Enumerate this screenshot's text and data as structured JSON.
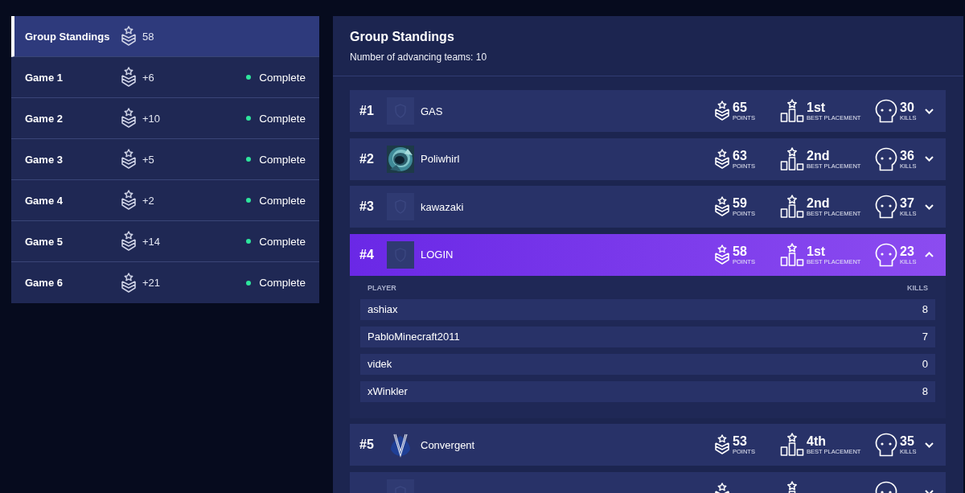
{
  "sidebar": {
    "items": [
      {
        "label": "Group Standings",
        "points": "58",
        "selected": true
      },
      {
        "label": "Game 1",
        "points": "+6",
        "status": "Complete",
        "selected": false
      },
      {
        "label": "Game 2",
        "points": "+10",
        "status": "Complete",
        "selected": false
      },
      {
        "label": "Game 3",
        "points": "+5",
        "status": "Complete",
        "selected": false
      },
      {
        "label": "Game 4",
        "points": "+2",
        "status": "Complete",
        "selected": false
      },
      {
        "label": "Game 5",
        "points": "+14",
        "status": "Complete",
        "selected": false
      },
      {
        "label": "Game 6",
        "points": "+21",
        "status": "Complete",
        "selected": false
      }
    ]
  },
  "panel": {
    "title": "Group Standings",
    "subtitle": "Number of advancing teams: 10"
  },
  "teams": [
    {
      "rank": "#1",
      "avatar": {
        "kind": "placeholder"
      },
      "name": "GAS",
      "points": "65",
      "points_label": "POINTS",
      "placement": "1st",
      "placement_label": "BEST PLACEMENT",
      "kills": "30",
      "kills_label": "KILLS",
      "expanded": false
    },
    {
      "rank": "#2",
      "name": "Poliwhirl",
      "points": "63",
      "points_label": "POINTS",
      "placement": "2nd",
      "placement_label": "BEST PLACEMENT",
      "kills": "36",
      "kills_label": "KILLS",
      "expanded": false
    },
    {
      "rank": "#3",
      "avatar": {
        "kind": "placeholder"
      },
      "name": "kawazaki",
      "points": "59",
      "points_label": "POINTS",
      "placement": "2nd",
      "placement_label": "BEST PLACEMENT",
      "kills": "37",
      "kills_label": "KILLS",
      "expanded": false
    },
    {
      "rank": "#4",
      "avatar": {
        "kind": "placeholder"
      },
      "name": "LOGIN",
      "points": "58",
      "points_label": "POINTS",
      "placement": "1st",
      "placement_label": "BEST PLACEMENT",
      "kills": "23",
      "kills_label": "KILLS",
      "expanded": true,
      "players": {
        "columns": [
          "PLAYER",
          "KILLS"
        ],
        "rows": [
          {
            "name": "ashiax",
            "kills": "8"
          },
          {
            "name": "PabloMinecraft2011",
            "kills": "7"
          },
          {
            "name": "videk",
            "kills": "0"
          },
          {
            "name": "xWinkler",
            "kills": "8"
          }
        ]
      }
    },
    {
      "rank": "#5",
      "avatar": {
        "kind": "logo"
      },
      "name": "Convergent",
      "points": "53",
      "points_label": "POINTS",
      "placement": "4th",
      "placement_label": "BEST PLACEMENT",
      "kills": "35",
      "kills_label": "KILLS",
      "expanded": false
    },
    {
      "avatar": {
        "kind": "placeholder"
      },
      "expanded": false
    }
  ]
}
